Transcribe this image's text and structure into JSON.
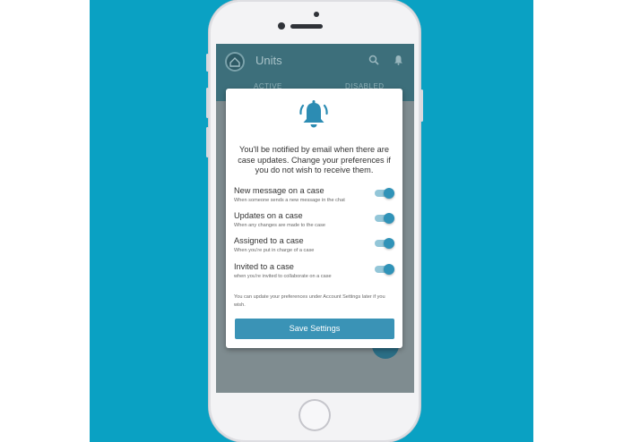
{
  "colors": {
    "background_accent": "#0aa1c3",
    "app_bar": "#3d6f7b",
    "primary_button": "#3a93b6",
    "toggle_on": "#3093b8",
    "bell_icon": "#2c8cb3"
  },
  "app": {
    "title": "Units",
    "tabs": [
      {
        "label": "ACTIVE"
      },
      {
        "label": "DISABLED"
      }
    ],
    "icons": {
      "logo": "home-icon",
      "search": "search-icon",
      "notifications": "bell-icon",
      "fab": "plus-icon"
    },
    "fab_label": "+"
  },
  "modal": {
    "icon": "bell-icon",
    "intro": "You'll be notified by email when there are case updates. Change your preferences if you do not wish to receive them.",
    "settings": [
      {
        "title": "New message on a case",
        "description": "When someone sends a new message in the chat",
        "enabled": true
      },
      {
        "title": "Updates on a case",
        "description": "When any changes are made to the case",
        "enabled": true
      },
      {
        "title": "Assigned to a case",
        "description": "When you're put in charge of a case",
        "enabled": true
      },
      {
        "title": "Invited to a case",
        "description": "when you're invited to collaborate on a case",
        "enabled": true
      }
    ],
    "footer_note": "You can update your preferences under Account Settings later if you wish.",
    "save_label": "Save Settings"
  }
}
